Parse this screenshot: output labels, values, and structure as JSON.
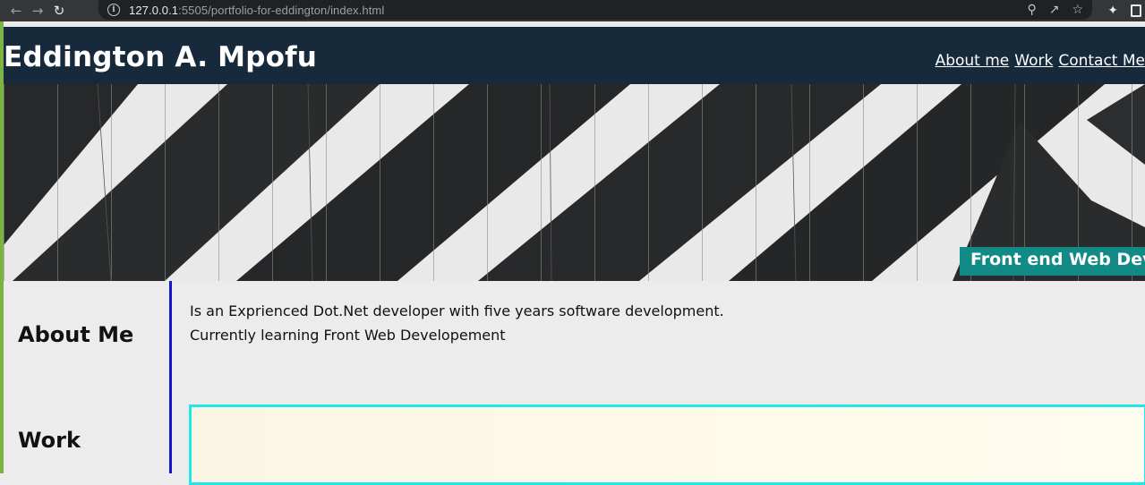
{
  "browser": {
    "url_host": "127.0.0.1",
    "url_rest": ":5505/portfolio-for-eddington/index.html",
    "icons": [
      "back-icon",
      "forward-icon",
      "reload-icon",
      "info-icon",
      "zoom-icon",
      "share-icon",
      "star-icon",
      "extensions-icon",
      "window-icon"
    ]
  },
  "header": {
    "title": "Eddington A. Mpofu",
    "nav": [
      "About me",
      "Work",
      "Contact Me"
    ]
  },
  "hero": {
    "tagline": "Front end Web Developer"
  },
  "sidebar": {
    "items": [
      "About Me",
      "Work"
    ]
  },
  "about": {
    "lines": [
      "Is an Exprienced Dot.Net developer with five years software development.",
      "Currently learning Front Web Developement"
    ]
  },
  "colors": {
    "header_bg": "#172a3c",
    "tag_bg": "#128a86",
    "sidebar_border": "#1616c8",
    "frame_border": "#1ee8e8"
  }
}
